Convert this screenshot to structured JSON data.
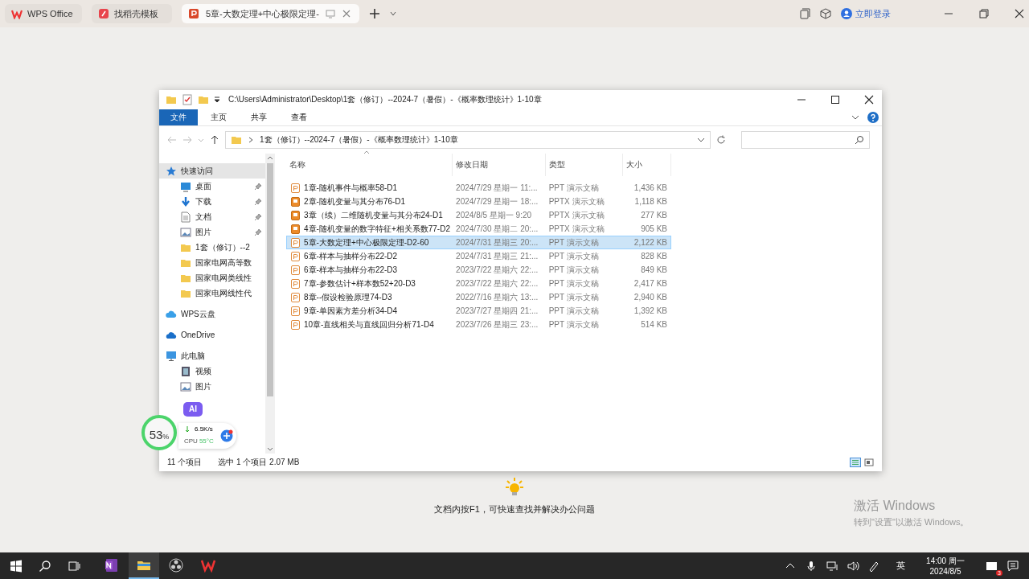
{
  "app_tabs": [
    {
      "kind": "wps",
      "label": "WPS Office",
      "selected": false
    },
    {
      "kind": "template",
      "label": "找稻壳模板",
      "selected": false
    },
    {
      "kind": "ppt",
      "label": "5章-大数定理+中心极限定理-",
      "selected": true
    }
  ],
  "app_bar": {
    "login": "立即登录"
  },
  "explorer": {
    "title_path": "C:\\Users\\Administrator\\Desktop\\1套（修订）--2024-7（暑假）-《概率数理统计》1-10章",
    "ribbon_tabs": [
      {
        "label": "文件",
        "selected": true
      },
      {
        "label": "主页",
        "selected": false
      },
      {
        "label": "共享",
        "selected": false
      },
      {
        "label": "查看",
        "selected": false
      }
    ],
    "address": "1套（修订）--2024-7（暑假）-《概率数理统计》1-10章",
    "nav": [
      {
        "kind": "star",
        "label": "快速访问",
        "selected": true,
        "pinned": false,
        "children": [
          {
            "kind": "desktop",
            "label": "桌面",
            "selected": false,
            "pinned": true
          },
          {
            "kind": "download",
            "label": "下载",
            "selected": false,
            "pinned": true
          },
          {
            "kind": "doc",
            "label": "文档",
            "selected": false,
            "pinned": true
          },
          {
            "kind": "picture",
            "label": "图片",
            "selected": false,
            "pinned": true
          },
          {
            "kind": "folder",
            "label": "1套（修订）--2",
            "selected": false,
            "pinned": false
          },
          {
            "kind": "folder",
            "label": "国家电网高等数",
            "selected": false,
            "pinned": false
          },
          {
            "kind": "folder",
            "label": "国家电网类线性",
            "selected": false,
            "pinned": false
          },
          {
            "kind": "folder",
            "label": "国家电网线性代",
            "selected": false,
            "pinned": false
          }
        ]
      },
      {
        "kind": "cloud",
        "label": "WPS云盘",
        "selected": false,
        "pinned": false
      },
      {
        "kind": "onedrive",
        "label": "OneDrive",
        "selected": false,
        "pinned": false
      },
      {
        "kind": "pc",
        "label": "此电脑",
        "selected": false,
        "pinned": false,
        "children": [
          {
            "kind": "video",
            "label": "视频",
            "selected": false,
            "pinned": false
          },
          {
            "kind": "picture",
            "label": "图片",
            "selected": false,
            "pinned": false
          }
        ]
      }
    ],
    "columns": [
      "名称",
      "修改日期",
      "类型",
      "大小"
    ],
    "files": [
      {
        "kind": "ppt",
        "name": "1章-随机事件与概率58-D1",
        "date": "2024/7/29 星期一 11:...",
        "type": "PPT 演示文稿",
        "size": "1,436 KB",
        "selected": false
      },
      {
        "kind": "pptx",
        "name": "2章-随机变量与其分布76-D1",
        "date": "2024/7/29 星期一 18:...",
        "type": "PPTX 演示文稿",
        "size": "1,118 KB",
        "selected": false
      },
      {
        "kind": "pptx",
        "name": "3章（续）二维随机变量与其分布24-D1",
        "date": "2024/8/5 星期一 9:20",
        "type": "PPTX 演示文稿",
        "size": "277 KB",
        "selected": false
      },
      {
        "kind": "pptx",
        "name": "4章-随机变量的数字特征+相关系数77-D2",
        "date": "2024/7/30 星期二 20:...",
        "type": "PPTX 演示文稿",
        "size": "905 KB",
        "selected": false
      },
      {
        "kind": "ppt",
        "name": "5章-大数定理+中心极限定理-D2-60",
        "date": "2024/7/31 星期三 20:...",
        "type": "PPT 演示文稿",
        "size": "2,122 KB",
        "selected": true
      },
      {
        "kind": "ppt",
        "name": "6章-样本与抽样分布22-D2",
        "date": "2024/7/31 星期三 21:...",
        "type": "PPT 演示文稿",
        "size": "828 KB",
        "selected": false
      },
      {
        "kind": "ppt",
        "name": "6章-样本与抽样分布22-D3",
        "date": "2023/7/22 星期六 22:...",
        "type": "PPT 演示文稿",
        "size": "849 KB",
        "selected": false
      },
      {
        "kind": "ppt",
        "name": "7章-参数估计+样本数52+20-D3",
        "date": "2023/7/22 星期六 22:...",
        "type": "PPT 演示文稿",
        "size": "2,417 KB",
        "selected": false
      },
      {
        "kind": "ppt",
        "name": "8章--假设检验原理74-D3",
        "date": "2022/7/16 星期六 13:...",
        "type": "PPT 演示文稿",
        "size": "2,940 KB",
        "selected": false
      },
      {
        "kind": "ppt",
        "name": "9章-单因素方差分析34-D4",
        "date": "2023/7/27 星期四 21:...",
        "type": "PPT 演示文稿",
        "size": "1,392 KB",
        "selected": false
      },
      {
        "kind": "ppt",
        "name": "10章-直线相关与直线回归分析71-D4",
        "date": "2023/7/26 星期三 23:...",
        "type": "PPT 演示文稿",
        "size": "514 KB",
        "selected": false
      }
    ],
    "status": {
      "count": "11 个项目",
      "selection": "选中 1 个项目  2.07 MB"
    }
  },
  "widget": {
    "percent": "53",
    "unit": "%",
    "ai": "AI",
    "speed": "6.5K/s",
    "cpu_label": "CPU",
    "cpu_temp": "55°C"
  },
  "hint": "文档内按F1，可快速查找并解决办公问题",
  "activation": {
    "title": "激活 Windows",
    "text": "转到\"设置\"以激活 Windows。"
  },
  "taskbar": {
    "apps": [
      {
        "kind": "onenote",
        "selected": false
      },
      {
        "kind": "explorer",
        "selected": true
      },
      {
        "kind": "obs",
        "selected": false
      },
      {
        "kind": "wps",
        "selected": false
      }
    ],
    "ime": "英",
    "time": "14:00 周一",
    "date": "2024/8/5",
    "badge": "3"
  }
}
